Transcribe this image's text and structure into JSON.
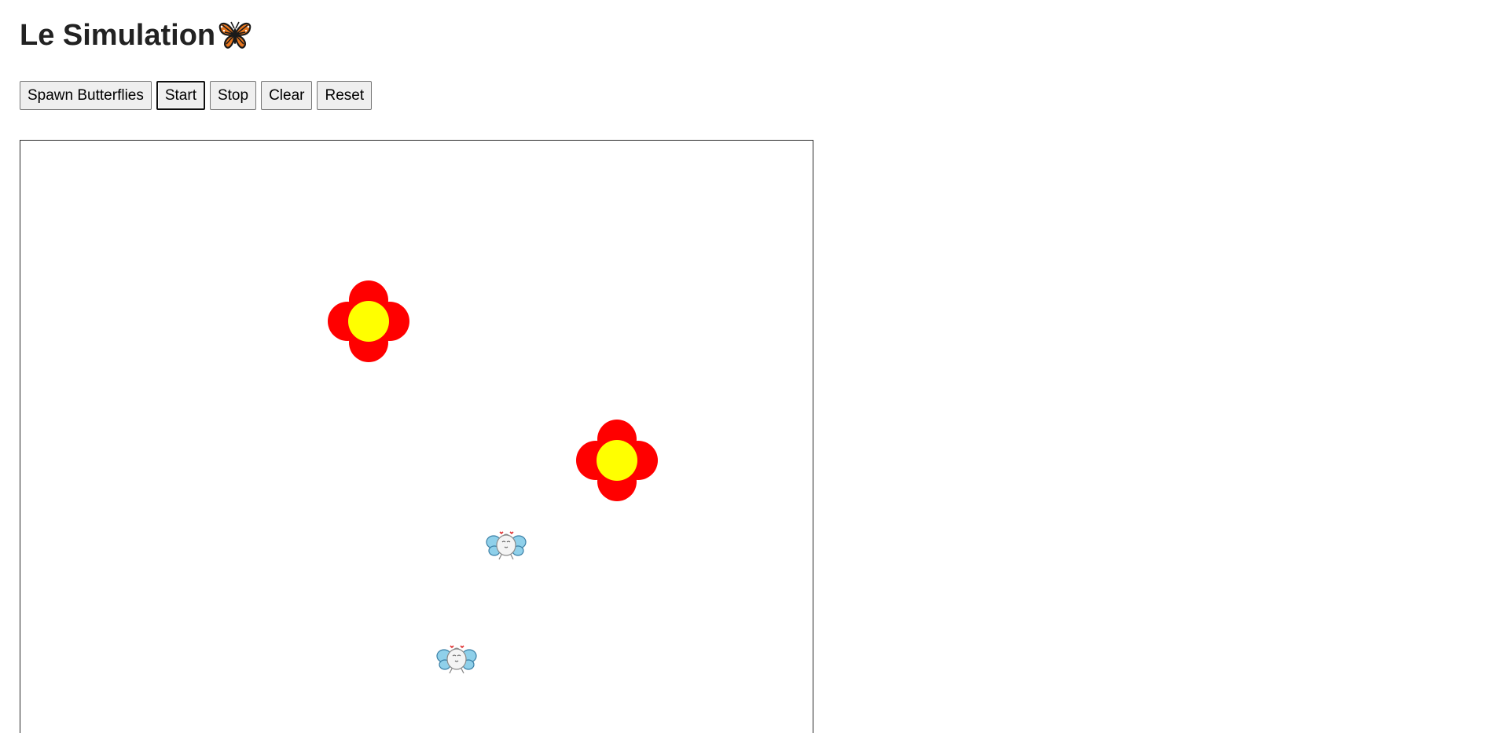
{
  "header": {
    "title": "Le Simulation",
    "title_icon": "butterfly-icon"
  },
  "toolbar": {
    "spawn_label": "Spawn Butterflies",
    "start_label": "Start",
    "stop_label": "Stop",
    "clear_label": "Clear",
    "reset_label": "Reset"
  },
  "simulation": {
    "flowers": [
      {
        "name": "flower",
        "petal_color": "#ff0000",
        "center_color": "#ffff00"
      },
      {
        "name": "flower",
        "petal_color": "#ff0000",
        "center_color": "#ffff00"
      }
    ],
    "butterflies": [
      {
        "name": "cartoon-butterfly-sprite",
        "wing_color": "#8fd0ea"
      },
      {
        "name": "cartoon-butterfly-sprite",
        "wing_color": "#8fd0ea"
      }
    ]
  },
  "colors": {
    "petal": "#ff0000",
    "flower_center": "#ffff00",
    "butterfly_wing": "#8fd0ea",
    "butterfly_body": "#f4f4f4",
    "canvas_border": "#2a2a2a",
    "button_bg": "#efefef"
  }
}
